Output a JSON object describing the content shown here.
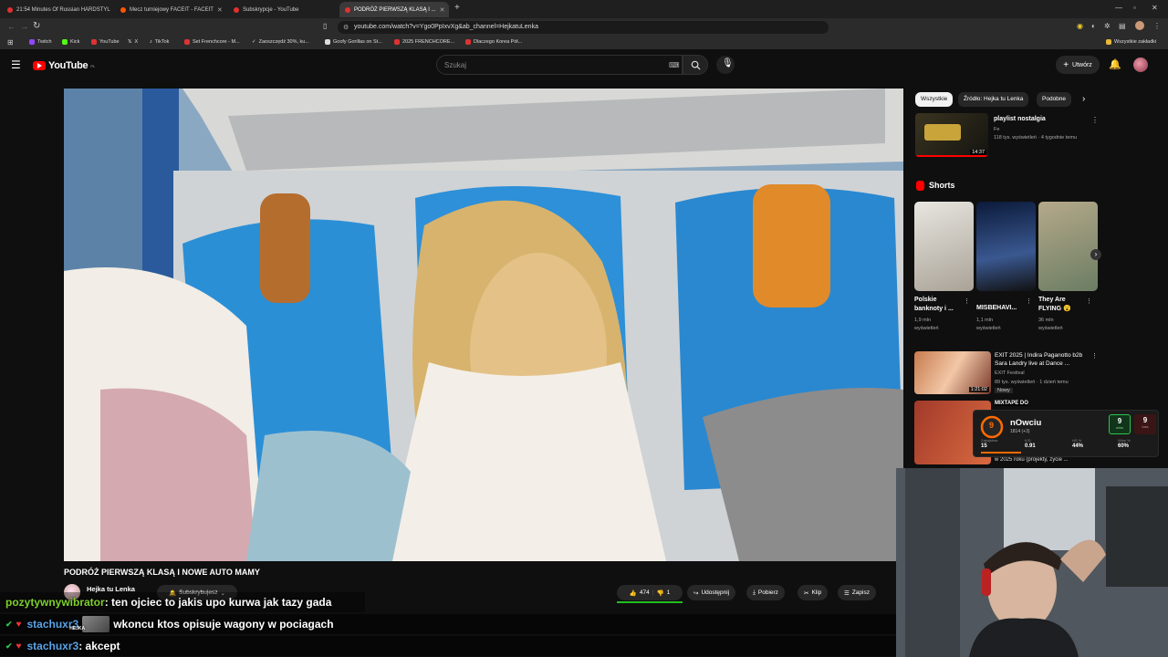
{
  "browser": {
    "tabs": [
      {
        "title": "21:54 Minutes Of Russian HARDSTYL"
      },
      {
        "title": "Mecz turniejowy FACEIT - FACEIT"
      },
      {
        "title": "Subskrypcje - YouTube"
      },
      {
        "title": "PODRÓŻ PIERWSZĄ KLASĄ I ..."
      }
    ],
    "url": "youtube.com/watch?v=Ygo0PpIxvXg&ab_channel=HejkatuLenka",
    "bookmarks": [
      "Twitch",
      "Kick",
      "YouTube",
      "X",
      "TikTok",
      "Set Frenchcore - M...",
      "Zaoszczędź 30%, ku...",
      "Goofy Gorillas on St...",
      "2025 FRENCHCORE...",
      "Dlaczego Korea Pół..."
    ],
    "all_bookmarks": "Wszystkie zakładki"
  },
  "youtube": {
    "logo": "YouTube",
    "logo_suffix": "PL",
    "search_placeholder": "Szukaj",
    "create_label": "Utwórz"
  },
  "video": {
    "title": "PODRÓŻ PIERWSZĄ KLASĄ I NOWE AUTO MAMY",
    "channel": "Hejka tu Lenka",
    "subscribe_label": "Subskrybujesz",
    "likes": "474",
    "dislikes": "1",
    "share": "Udostępnij",
    "download": "Pobierz",
    "clip": "Klip",
    "save": "Zapisz"
  },
  "sidebar": {
    "chips": [
      "Wszystkie",
      "Źródło: Hejka tu Lenka",
      "Podobne"
    ],
    "playlist": {
      "title": "playlist nostalgia",
      "author": "Fe",
      "meta": "118 tys. wyświetleń · 4 tygodnie temu",
      "duration": "14:37"
    },
    "shorts_heading": "Shorts",
    "shorts": [
      {
        "title": "Polskie banknoty i ...",
        "views": "1,9 mln",
        "suffix": "wyświetleń"
      },
      {
        "title": "MISBEHAVI...",
        "views": "1,1 mln",
        "suffix": "wyświetleń"
      },
      {
        "title": "They Are FLYING 😮",
        "views": "36 mln",
        "suffix": "wyświetleń"
      }
    ],
    "video1": {
      "title": "EXIT 2025 | Indira Paganotto b2b Sara Landry live at Dance ...",
      "channel": "EXIT Festival",
      "meta": "89 tys. wyświetleń · 1 dzień temu",
      "badge": "Nowy",
      "duration": "1:21:02"
    },
    "video2": {
      "title": "MIXTAPE DO",
      "meta": "w 2025 roku (projekty, życie ..."
    }
  },
  "faceit": {
    "level": "9",
    "name": "nOwciu",
    "elo": "1814 (+3)",
    "stats": [
      {
        "label": "Zabójstwa",
        "value": "15"
      },
      {
        "label": "K/D",
        "value": "0.91"
      },
      {
        "label": "HS %",
        "value": "44%"
      },
      {
        "label": "Wins %",
        "value": "60%"
      }
    ],
    "score": [
      {
        "value": "9",
        "label": "wins"
      },
      {
        "value": "9",
        "label": "loss"
      }
    ]
  },
  "chat": [
    {
      "user": "pozytywnywibrator",
      "message": " : ten ojciec to jakis upo kurwa jak tazy gada",
      "color": "#7fd12b",
      "badge": false
    },
    {
      "user": "stachuxr3",
      "message": "wkoncu ktos opisuje wagony w pociagach",
      "color": "#5aa3e8",
      "badge": true,
      "emote_label": "HEJKA"
    },
    {
      "user": "stachuxr3",
      "message": " : akcept",
      "color": "#5aa3e8",
      "badge": true
    }
  ]
}
